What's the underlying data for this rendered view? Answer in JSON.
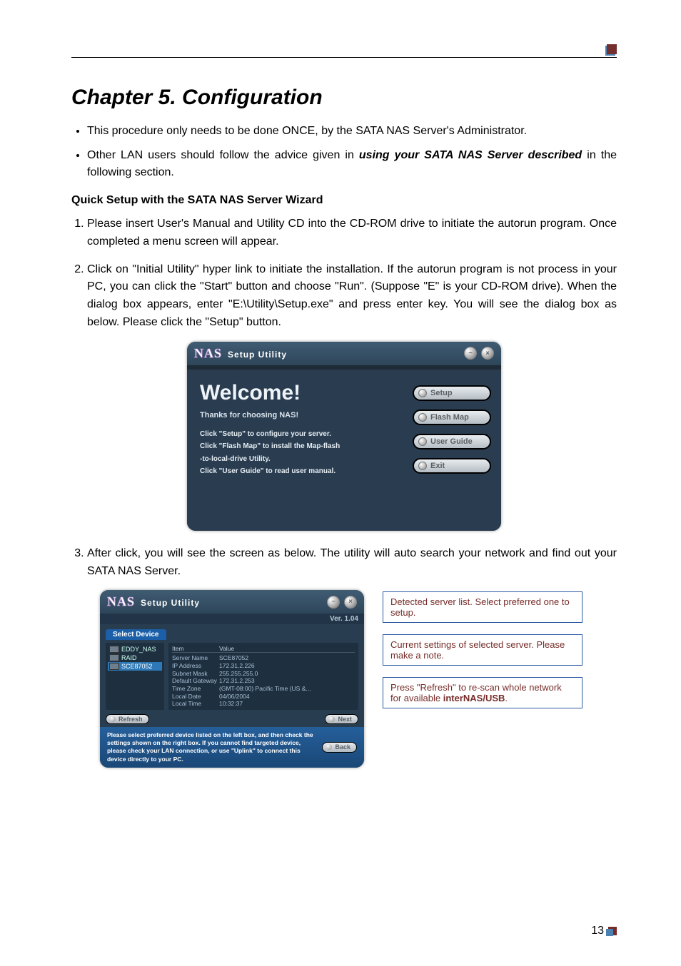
{
  "header": {
    "chapter_title": "Chapter 5. Configuration"
  },
  "bullets": [
    {
      "pre": "This procedure only needs to be done ONCE, by the SATA NAS Server's Administrator.",
      "emph": "",
      "post": ""
    },
    {
      "pre": "Other LAN users should follow the advice given in ",
      "emph": "using your SATA NAS Server described",
      "post": " in the following section."
    }
  ],
  "section_heading": "Quick Setup with the SATA NAS Server Wizard",
  "steps": [
    "Please insert User's Manual and Utility CD into the CD-ROM drive to initiate the autorun program. Once completed a menu screen will appear.",
    "Click on \"Initial Utility\" hyper link to initiate the installation. If the autorun program is not process in your PC, you can click the \"Start\" button and choose \"Run\". (Suppose \"E\" is your CD-ROM drive). When the dialog box appears, enter \"E:\\Utility\\Setup.exe\" and press enter key. You will see the dialog box as below. Please click the \"Setup\" button.",
    "After click, you will see the screen as below. The utility will auto search your network and find out your SATA NAS Server."
  ],
  "fig1": {
    "logo": "NAS",
    "title": "Setup Utility",
    "welcome": "Welcome!",
    "thanks": "Thanks for choosing NAS!",
    "line1": "Click \"Setup\" to configure your server.",
    "line2a": "Click \"Flash Map\" to install the Map-flash",
    "line2b": "-to-local-drive Utility.",
    "line3": "Click \"User Guide\" to read user manual.",
    "buttons": {
      "setup": "Setup",
      "flashmap": "Flash Map",
      "userguide": "User Guide",
      "exit": "Exit"
    }
  },
  "fig2": {
    "logo": "NAS",
    "title": "Setup Utility",
    "version": "Ver. 1.04",
    "select_tab": "Select Device",
    "devices": [
      "EDDY_NAS",
      "RAID",
      "SCE87052"
    ],
    "table_header": {
      "c1": "Item",
      "c2": "Value"
    },
    "rows": [
      {
        "k": "Server Name",
        "v": "SCE87052"
      },
      {
        "k": "IP Address",
        "v": "172.31.2.226"
      },
      {
        "k": "Subnet Mask",
        "v": "255.255.255.0"
      },
      {
        "k": "Default Gateway",
        "v": "172.31.2.253"
      },
      {
        "k": "Time Zone",
        "v": "(GMT-08:00) Pacific Time (US &..."
      },
      {
        "k": "Local Date",
        "v": "04/06/2004"
      },
      {
        "k": "Local Time",
        "v": "10:32:37"
      }
    ],
    "refresh": "Refresh",
    "next": "Next",
    "back": "Back",
    "footer_note": "Please select preferred device listed on the left box, and then check the settings shown on the right box. If you cannot find targeted device, please check your LAN connection, or use \"Uplink\" to connect this device directly to your PC."
  },
  "callouts": {
    "c1": "Detected server list. Select preferred one to setup.",
    "c2": "Current settings of selected server. Please make a note.",
    "c3_pre": "Press \"Refresh\"  to re-scan whole network for available ",
    "c3_bold": "interNAS/USB",
    "c3_post": "."
  },
  "page_number": "13"
}
